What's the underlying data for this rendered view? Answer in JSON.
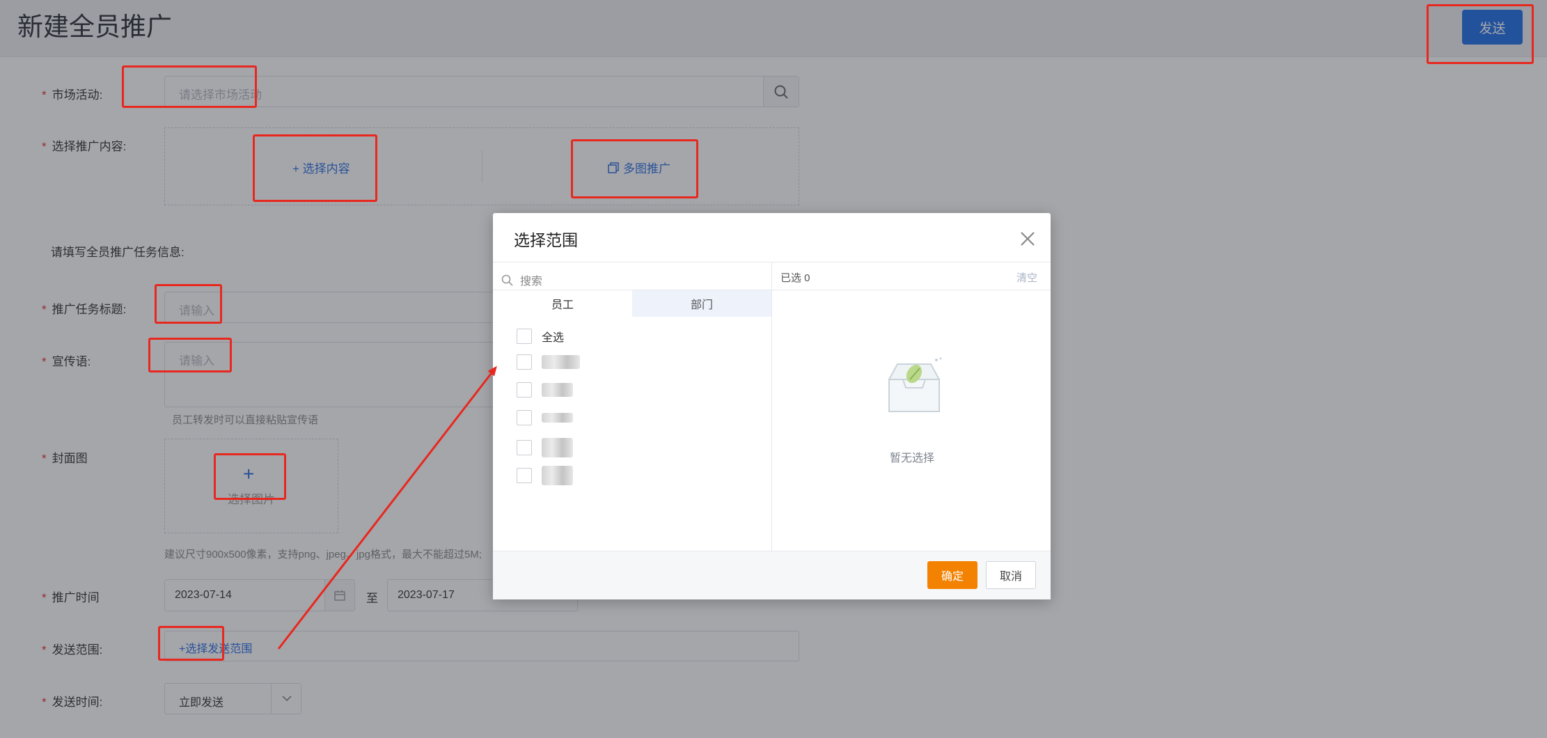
{
  "header": {
    "title": "新建全员推广",
    "send_label": "发送"
  },
  "form": {
    "activity": {
      "label": "市场活动:",
      "placeholder": "请选择市场活动"
    },
    "content": {
      "label": "选择推广内容:",
      "select_content": "+ 选择内容",
      "multi_image": "多图推广"
    },
    "task_info_heading": "请填写全员推广任务信息:",
    "task_title": {
      "label": "推广任务标题:",
      "placeholder": "请输入"
    },
    "slogan": {
      "label": "宣传语:",
      "placeholder": "请输入",
      "hint": "员工转发时可以直接粘贴宣传语"
    },
    "cover": {
      "label": "封面图",
      "plus": "+",
      "select_image": "选择图片",
      "hint": "建议尺寸900x500像素，支持png、jpeg、jpg格式，最大不能超过5M;"
    },
    "promo_time": {
      "label": "推广时间",
      "start": "2023-07-14",
      "to": "至",
      "end": "2023-07-17"
    },
    "scope": {
      "label": "发送范围:",
      "link": "+选择发送范围"
    },
    "send_time": {
      "label": "发送时间:",
      "value": "立即发送"
    }
  },
  "modal": {
    "title": "选择范围",
    "search_placeholder": "搜索",
    "tabs": [
      "员工",
      "部门"
    ],
    "select_all": "全选",
    "selected_count": "已选 0",
    "clear": "清空",
    "empty_text": "暂无选择",
    "ok": "确定",
    "cancel": "取消"
  },
  "colors": {
    "primary": "#1f6fe8",
    "accent": "#f38200",
    "annotation": "#e8271f",
    "required": "#e02b2b"
  }
}
